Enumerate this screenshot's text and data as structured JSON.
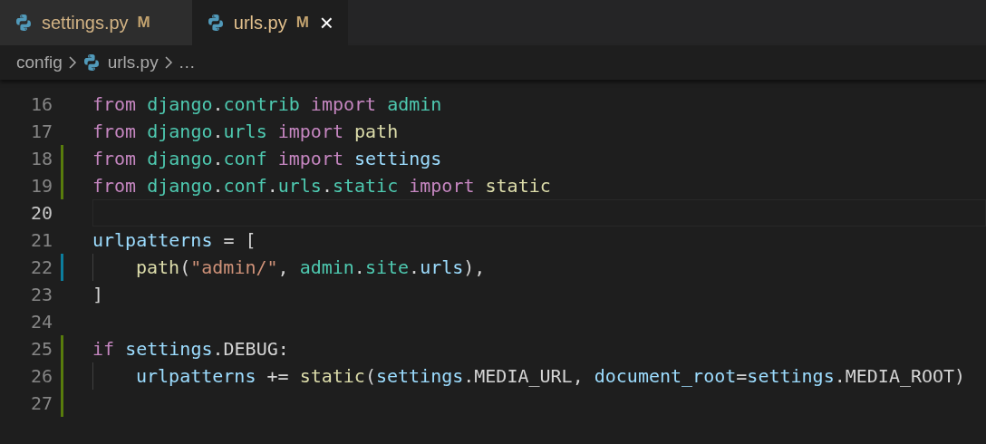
{
  "tabs": [
    {
      "label": "settings.py",
      "badge": "M",
      "selected": false
    },
    {
      "label": "urls.py",
      "badge": "M",
      "selected": true,
      "close": "×"
    }
  ],
  "breadcrumb": [
    {
      "kind": "folder",
      "label": "config"
    },
    {
      "kind": "file",
      "label": "urls.py"
    },
    {
      "kind": "more",
      "label": "…"
    }
  ],
  "editor": {
    "lines": [
      {
        "number": "16",
        "added": false,
        "modified": false,
        "indented": false,
        "current": false,
        "tokens": [
          {
            "kind": "keyword",
            "text": "from"
          },
          {
            "kind": "module",
            "text": " django"
          },
          {
            "kind": "plain",
            "text": "."
          },
          {
            "kind": "module",
            "text": "contrib"
          },
          {
            "kind": "keyword",
            "text": " import"
          },
          {
            "kind": "module",
            "text": " admin"
          }
        ]
      },
      {
        "number": "17",
        "added": false,
        "modified": false,
        "indented": false,
        "current": false,
        "tokens": [
          {
            "kind": "keyword",
            "text": "from"
          },
          {
            "kind": "module",
            "text": " django"
          },
          {
            "kind": "plain",
            "text": "."
          },
          {
            "kind": "module",
            "text": "urls"
          },
          {
            "kind": "keyword",
            "text": " import"
          },
          {
            "kind": "function",
            "text": " path"
          }
        ]
      },
      {
        "number": "18",
        "added": true,
        "modified": false,
        "indented": false,
        "current": false,
        "tokens": [
          {
            "kind": "keyword",
            "text": "from"
          },
          {
            "kind": "module",
            "text": " django"
          },
          {
            "kind": "plain",
            "text": "."
          },
          {
            "kind": "module",
            "text": "conf"
          },
          {
            "kind": "keyword",
            "text": " import"
          },
          {
            "kind": "variable",
            "text": " settings"
          }
        ]
      },
      {
        "number": "19",
        "added": true,
        "modified": false,
        "indented": false,
        "current": false,
        "tokens": [
          {
            "kind": "keyword",
            "text": "from"
          },
          {
            "kind": "module",
            "text": " django"
          },
          {
            "kind": "plain",
            "text": "."
          },
          {
            "kind": "module",
            "text": "conf"
          },
          {
            "kind": "plain",
            "text": "."
          },
          {
            "kind": "module",
            "text": "urls"
          },
          {
            "kind": "plain",
            "text": "."
          },
          {
            "kind": "module",
            "text": "static"
          },
          {
            "kind": "keyword",
            "text": " import"
          },
          {
            "kind": "function",
            "text": " static"
          }
        ]
      },
      {
        "number": "20",
        "added": false,
        "modified": false,
        "indented": false,
        "current": true
      },
      {
        "number": "21",
        "added": false,
        "modified": false,
        "indented": false,
        "current": false,
        "tokens": [
          {
            "kind": "variable",
            "text": "urlpatterns"
          },
          {
            "kind": "plain",
            "text": " = ["
          }
        ]
      },
      {
        "number": "22",
        "added": false,
        "modified": true,
        "indented": true,
        "current": false,
        "tokens": [
          {
            "kind": "function",
            "text": "path"
          },
          {
            "kind": "plain",
            "text": "("
          },
          {
            "kind": "string",
            "text": "\"admin/\""
          },
          {
            "kind": "plain",
            "text": ", "
          },
          {
            "kind": "module",
            "text": "admin"
          },
          {
            "kind": "plain",
            "text": "."
          },
          {
            "kind": "module",
            "text": "site"
          },
          {
            "kind": "plain",
            "text": "."
          },
          {
            "kind": "variable",
            "text": "urls"
          },
          {
            "kind": "plain",
            "text": "),"
          }
        ]
      },
      {
        "number": "23",
        "added": false,
        "modified": false,
        "indented": false,
        "current": false,
        "tokens": [
          {
            "kind": "plain",
            "text": "]"
          }
        ]
      },
      {
        "number": "24",
        "added": false,
        "modified": false,
        "indented": false,
        "current": false
      },
      {
        "number": "25",
        "added": true,
        "modified": false,
        "indented": false,
        "current": false,
        "tokens": [
          {
            "kind": "keyword",
            "text": "if"
          },
          {
            "kind": "variable",
            "text": " settings"
          },
          {
            "kind": "plain",
            "text": ".DEBUG:"
          }
        ]
      },
      {
        "number": "26",
        "added": true,
        "modified": false,
        "indented": true,
        "current": false,
        "tokens": [
          {
            "kind": "variable",
            "text": "urlpatterns"
          },
          {
            "kind": "plain",
            "text": " += "
          },
          {
            "kind": "function",
            "text": "static"
          },
          {
            "kind": "plain",
            "text": "("
          },
          {
            "kind": "variable",
            "text": "settings"
          },
          {
            "kind": "plain",
            "text": ".MEDIA_URL, "
          },
          {
            "kind": "variable",
            "text": "document_root"
          },
          {
            "kind": "plain",
            "text": "="
          },
          {
            "kind": "variable",
            "text": "settings"
          },
          {
            "kind": "plain",
            "text": ".MEDIA_ROOT)"
          }
        ]
      },
      {
        "number": "27",
        "added": true,
        "modified": false,
        "indented": false,
        "current": false
      }
    ]
  }
}
